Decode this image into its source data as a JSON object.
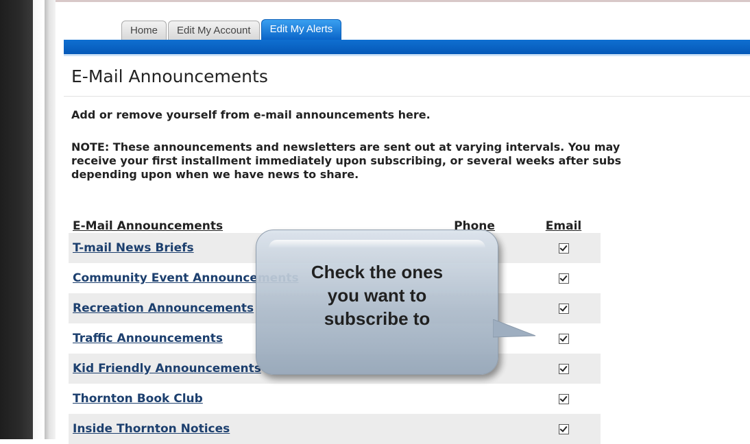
{
  "tabs": [
    {
      "label": "Home"
    },
    {
      "label": "Edit My Account"
    },
    {
      "label": "Edit My Alerts"
    }
  ],
  "page": {
    "title": "E-Mail Announcements",
    "intro": "Add or remove yourself from e-mail announcements here.",
    "note_lines": [
      "NOTE: These announcements and newsletters are sent out at varying intervals. You may",
      "receive your first installment immediately upon subscribing, or several weeks after subs",
      "depending upon when we have news to share."
    ]
  },
  "table": {
    "headers": {
      "name": "E-Mail Announcements",
      "phone": "Phone",
      "email": "Email"
    },
    "rows": [
      {
        "label": "T-mail News Briefs",
        "email_checked": true
      },
      {
        "label": "Community Event Announcements",
        "email_checked": true
      },
      {
        "label": "Recreation Announcements",
        "email_checked": true
      },
      {
        "label": "Traffic Announcements",
        "email_checked": true
      },
      {
        "label": "Kid Friendly Announcements",
        "email_checked": true
      },
      {
        "label": "Thornton Book Club",
        "email_checked": true
      },
      {
        "label": "Inside Thornton Notices",
        "email_checked": true
      }
    ]
  },
  "callout": {
    "lines": [
      "Check the ones",
      "you want to",
      "subscribe to"
    ]
  },
  "colors": {
    "active_tab": "#0a64c8",
    "tab_bar": "#0558b8",
    "link": "#1c3f6e"
  }
}
